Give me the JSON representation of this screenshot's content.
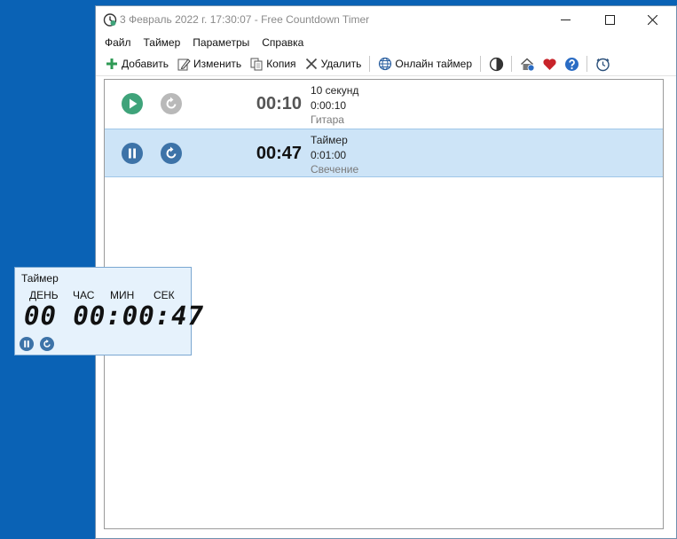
{
  "window": {
    "title": "3 Февраль 2022 г. 17:30:07 - Free Countdown Timer"
  },
  "menu": {
    "items": [
      "Файл",
      "Таймер",
      "Параметры",
      "Справка"
    ]
  },
  "toolbar": {
    "add_label": "Добавить",
    "edit_label": "Изменить",
    "copy_label": "Копия",
    "delete_label": "Удалить",
    "online_label": "Онлайн таймер"
  },
  "timers": [
    {
      "time": "00:10",
      "name": "10 секунд",
      "duration": "0:00:10",
      "sound": "Гитара",
      "state": "stopped"
    },
    {
      "time": "00:47",
      "name": "Таймер",
      "duration": "0:01:00",
      "sound": "Свечение",
      "state": "running"
    }
  ],
  "widget": {
    "title": "Таймер",
    "labels": {
      "days": "ДЕНЬ",
      "hours": "ЧАС",
      "minutes": "МИН",
      "seconds": "СЕК"
    },
    "display": "00 00:00:47"
  },
  "colors": {
    "desktop": "#0a62b5",
    "selected_row": "#cde4f7",
    "play_green": "#3fa37a",
    "control_blue": "#3d73a8",
    "disabled_gray": "#b9b9b9",
    "heart_red": "#c8242a",
    "help_blue": "#2a6cc4"
  }
}
